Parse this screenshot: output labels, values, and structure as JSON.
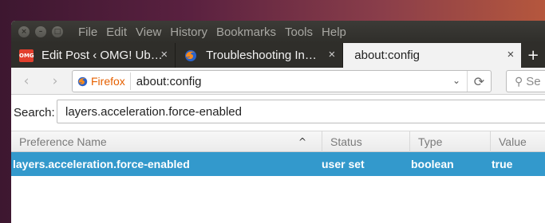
{
  "menu": [
    "File",
    "Edit",
    "View",
    "History",
    "Bookmarks",
    "Tools",
    "Help"
  ],
  "window_controls": {
    "close": "×",
    "minimize": "–",
    "maximize": "□"
  },
  "tabs": [
    {
      "title": "Edit Post ‹ OMG! Ub…",
      "favicon": "omg-logo-icon",
      "favicon_text": "OMG"
    },
    {
      "title": "Troubleshooting In…",
      "favicon": "firefox-logo-icon"
    },
    {
      "title": "about:config",
      "favicon": "",
      "active": true
    }
  ],
  "tab_close": "×",
  "new_tab": "+",
  "nav": {
    "back": "‹",
    "forward": "›",
    "identity_label": "Firefox",
    "url": "about:config",
    "dropdown": "⌄",
    "reload": "⟳",
    "search_placeholder": "Se"
  },
  "filter": {
    "label": "Search:",
    "value": "layers.acceleration.force-enabled"
  },
  "table": {
    "columns": [
      "Preference Name",
      "Status",
      "Type",
      "Value"
    ],
    "sort_arrow": "^",
    "rows": [
      {
        "name": "layers.acceleration.force-enabled",
        "status": "user set",
        "type": "boolean",
        "value": "true"
      }
    ]
  },
  "colors": {
    "titlebar": "#3c3b37",
    "selected_row": "#3399cc",
    "firefox_label": "#e66000"
  }
}
